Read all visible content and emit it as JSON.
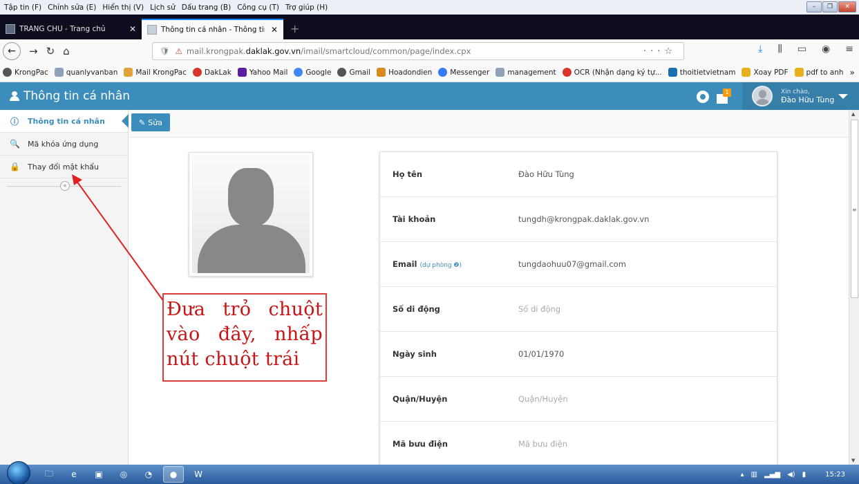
{
  "menubar": [
    "Tập tin (F)",
    "Chỉnh sửa (E)",
    "Hiển thị (V)",
    "Lịch sử",
    "Dấu trang (B)",
    "Công cụ (T)",
    "Trợ giúp (H)"
  ],
  "tabs": [
    {
      "label": "TRANG CHỦ - Trang chủ"
    },
    {
      "label": "Thông tin cá nhân - Thông tin cá nhân"
    }
  ],
  "url": {
    "prefix": "mail.krongpak.",
    "domain": "daklak.gov.vn",
    "path": "/imail/smartcloud/common/page/index.cpx"
  },
  "bookmarks": [
    {
      "label": "KrongPac",
      "color": "#555"
    },
    {
      "label": "quanlyvanban",
      "color": "#8fa3b8"
    },
    {
      "label": "Mail KrongPac",
      "color": "#e2a23a"
    },
    {
      "label": "DakLak",
      "color": "#d9362b"
    },
    {
      "label": "Yahoo Mail",
      "color": "#5a1fa0"
    },
    {
      "label": "Google",
      "color": "#4285f4"
    },
    {
      "label": "Gmail",
      "color": "#555"
    },
    {
      "label": "Hoadondien",
      "color": "#d98b1e"
    },
    {
      "label": "Messenger",
      "color": "#2f7cf6"
    },
    {
      "label": "management",
      "color": "#8fa3b8"
    },
    {
      "label": "OCR (Nhận dạng ký tự...",
      "color": "#d9362b"
    },
    {
      "label": "thoitietvietnam",
      "color": "#1b6fb0"
    },
    {
      "label": "Xoay PDF",
      "color": "#e6b01e"
    },
    {
      "label": "pdf to anh",
      "color": "#e6b01e"
    }
  ],
  "app": {
    "title": "Thông tin cá nhân",
    "notif_count": "1",
    "greeting": "Xin chào,",
    "user_name": "Đào Hữu Tùng"
  },
  "sidebar": {
    "items": [
      {
        "label": "Thông tin cá nhân",
        "icon": "info-icon"
      },
      {
        "label": "Mã khóa ứng dụng",
        "icon": "key-icon"
      },
      {
        "label": "Thay đổi mật khẩu",
        "icon": "lock-icon"
      }
    ],
    "collapse_glyph": "«"
  },
  "toolbar": {
    "edit_label": "Sửa"
  },
  "profile": {
    "rows": [
      {
        "label": "Họ tên",
        "value": "Đào Hữu Tùng",
        "placeholder": false
      },
      {
        "label": "Tài khoản",
        "value": "tungdh@krongpak.daklak.gov.vn",
        "placeholder": false
      },
      {
        "label": "Email",
        "sublabel": "(dự phòng ❷)",
        "value": "tungdaohuu07@gmail.com",
        "placeholder": false
      },
      {
        "label": "Số di động",
        "value": "Số di động",
        "placeholder": true
      },
      {
        "label": "Ngày sinh",
        "value": "01/01/1970",
        "placeholder": false
      },
      {
        "label": "Quận/Huyện",
        "value": "Quận/Huyện",
        "placeholder": true
      },
      {
        "label": "Mã bưu điện",
        "value": "Mã bưu điện",
        "placeholder": true
      }
    ]
  },
  "callout": {
    "text": "Đưa trỏ chuột vào đây, nhấp nút chuột trái"
  },
  "taskbar": {
    "time": "15:23"
  }
}
